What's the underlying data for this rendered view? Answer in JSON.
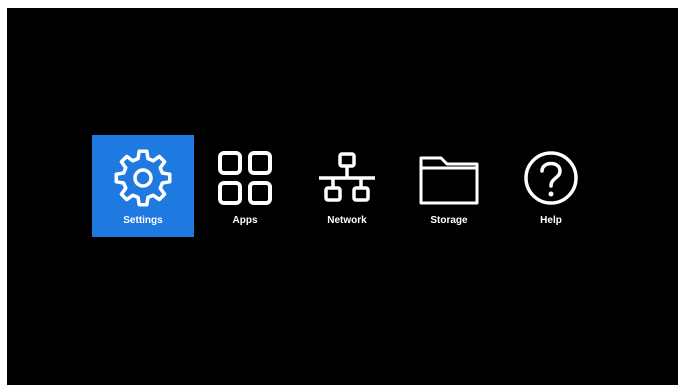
{
  "colors": {
    "background": "#000000",
    "selected_tile": "#1e7ae0",
    "foreground": "#ffffff"
  },
  "menu": {
    "selected": "Settings",
    "items": [
      {
        "label": "Settings",
        "icon": "gear-icon"
      },
      {
        "label": "Apps",
        "icon": "apps-grid-icon"
      },
      {
        "label": "Network",
        "icon": "network-icon"
      },
      {
        "label": "Storage",
        "icon": "folder-icon"
      },
      {
        "label": "Help",
        "icon": "help-icon"
      }
    ]
  }
}
